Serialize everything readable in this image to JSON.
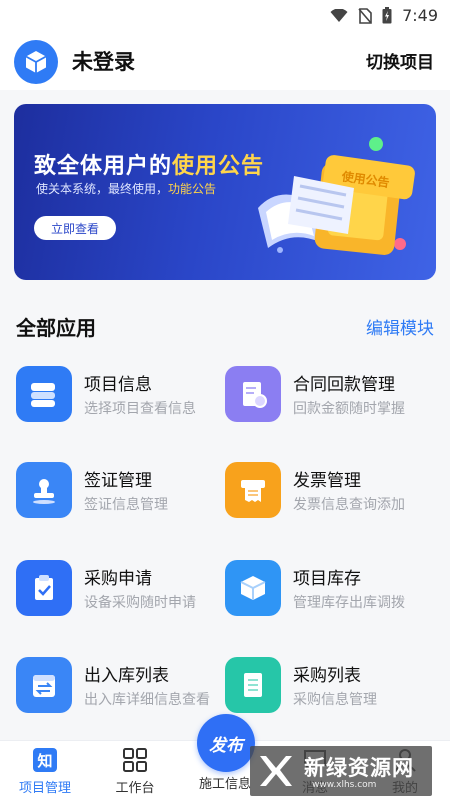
{
  "status_bar": {
    "time": "7:49"
  },
  "header": {
    "login_status": "未登录",
    "switch_project": "切换项目"
  },
  "banner": {
    "title_prefix": "致全体用户的",
    "title_highlight": "使用公告",
    "subtitle_prefix": "使关本系统，最终使用，",
    "subtitle_highlight": "功能公告",
    "button": "立即查看",
    "badge": "使用公告"
  },
  "section": {
    "title": "全部应用",
    "edit": "编辑模块"
  },
  "apps": [
    {
      "name": "项目信息",
      "desc": "选择项目查看信息",
      "icon": "books-icon",
      "color": "#2f7bf5"
    },
    {
      "name": "合同回款管理",
      "desc": "回款金额随时掌握",
      "icon": "contract-icon",
      "color": "#8b7ef2"
    },
    {
      "name": "签证管理",
      "desc": "签证信息管理",
      "icon": "stamp-icon",
      "color": "#3a86f6"
    },
    {
      "name": "发票管理",
      "desc": "发票信息查询添加",
      "icon": "invoice-icon",
      "color": "#f8a21c"
    },
    {
      "name": "采购申请",
      "desc": "设备采购随时申请",
      "icon": "clipboard-icon",
      "color": "#2f6ff5"
    },
    {
      "name": "项目库存",
      "desc": "管理库存出库调拨",
      "icon": "box-icon",
      "color": "#2f95f5"
    },
    {
      "name": "出入库列表",
      "desc": "出入库详细信息查看",
      "icon": "inout-icon",
      "color": "#3a86f6"
    },
    {
      "name": "采购列表",
      "desc": "采购信息管理",
      "icon": "list-icon",
      "color": "#26c6a8"
    }
  ],
  "tabbar": {
    "items": [
      {
        "label": "项目管理",
        "active": true
      },
      {
        "label": "工作台",
        "active": false
      },
      {
        "label": "施工信息",
        "active": false
      },
      {
        "label": "消息",
        "active": false
      },
      {
        "label": "我的",
        "active": false
      }
    ],
    "fab_label": "发布",
    "tab_icon_text": "知"
  },
  "watermark": {
    "main": "新绿资源网",
    "sub": "www.xlhs.com"
  },
  "colors": {
    "accent": "#2f7bf5",
    "banner_dark": "#1d2e9e",
    "highlight": "#ffd54a"
  }
}
